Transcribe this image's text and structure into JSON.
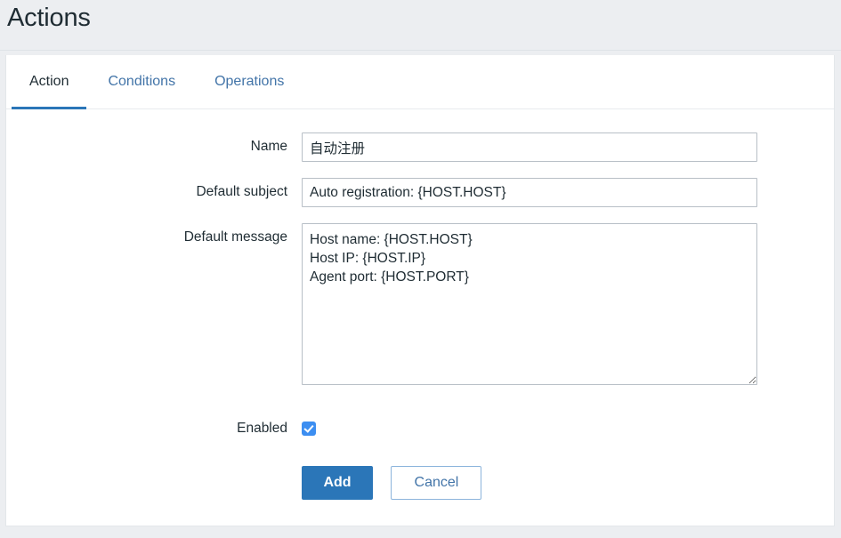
{
  "header": {
    "title": "Actions"
  },
  "tabs": [
    {
      "label": "Action",
      "active": true
    },
    {
      "label": "Conditions",
      "active": false
    },
    {
      "label": "Operations",
      "active": false
    }
  ],
  "form": {
    "name": {
      "label": "Name",
      "value": "自动注册",
      "placeholder": ""
    },
    "default_subject": {
      "label": "Default subject",
      "value": "Auto registration: {HOST.HOST}",
      "placeholder": ""
    },
    "default_message": {
      "label": "Default message",
      "value": "Host name: {HOST.HOST}\nHost IP: {HOST.IP}\nAgent port: {HOST.PORT}",
      "placeholder": ""
    },
    "enabled": {
      "label": "Enabled",
      "checked": true
    }
  },
  "buttons": {
    "add": "Add",
    "cancel": "Cancel"
  },
  "colors": {
    "accent": "#2b76b8",
    "link": "#4274a8",
    "checkbox": "#3c8ef1",
    "page_bg": "#eceef1",
    "card_bg": "#ffffff",
    "input_border": "#b8bfc6"
  }
}
